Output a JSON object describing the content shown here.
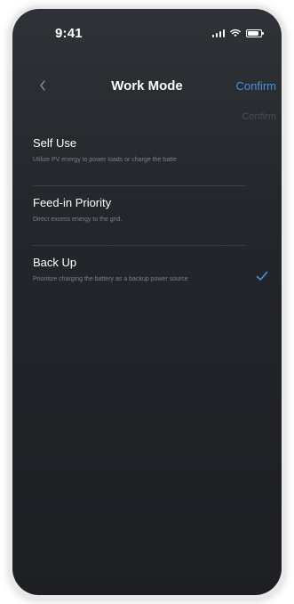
{
  "status_bar": {
    "time": "9:41",
    "icons": [
      "signal-icon",
      "wifi-icon",
      "battery-icon"
    ]
  },
  "nav": {
    "back_icon": "chevron-left-icon",
    "title": "Work Mode",
    "confirm_label": "Confirm",
    "confirm_ghost_label": "Confirm"
  },
  "colors": {
    "accent": "#4a8fe0",
    "background": "#23262b",
    "secondary_text": "#7c8188"
  },
  "modes": [
    {
      "title": "Self Use",
      "description": "Utilize PV energy to power loads or charge the batte",
      "selected": false
    },
    {
      "title": "Feed-in Priority",
      "description": "Direct excess energy to the grid.",
      "selected": false
    },
    {
      "title": "Back Up",
      "description": "Prioritize charging the battery as a backup power source",
      "selected": true
    }
  ]
}
